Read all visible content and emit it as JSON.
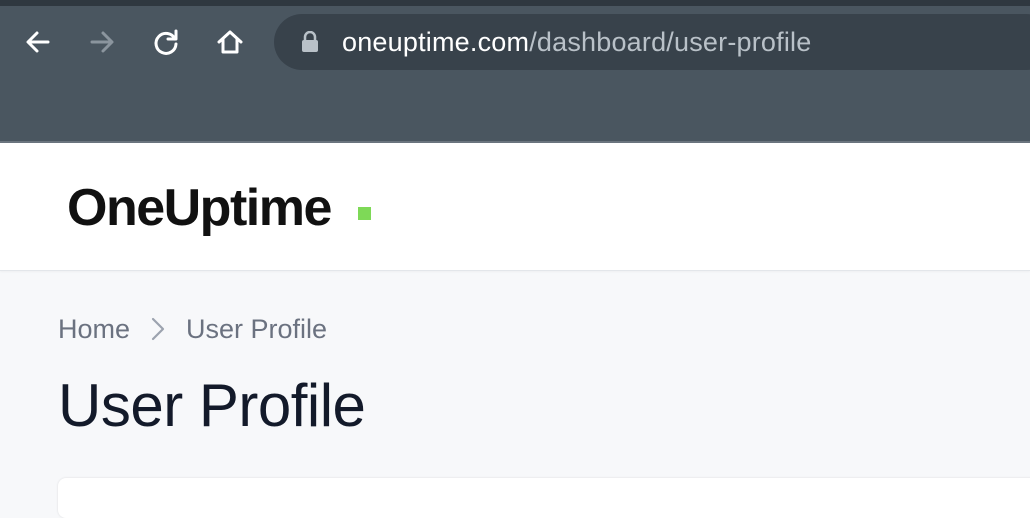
{
  "browser": {
    "url_host": "oneuptime.com",
    "url_path": "/dashboard/user-profile",
    "icons": {
      "back": "arrow-left-icon",
      "forward": "arrow-right-icon",
      "reload": "reload-icon",
      "home": "home-icon",
      "lock": "lock-icon"
    }
  },
  "header": {
    "logo_text": "OneUptime",
    "logo_accent_color": "#7ed957"
  },
  "breadcrumb": {
    "items": [
      "Home",
      "User Profile"
    ]
  },
  "page": {
    "title": "User Profile"
  }
}
